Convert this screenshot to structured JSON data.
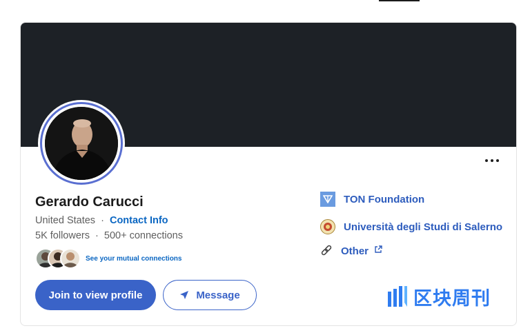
{
  "profile": {
    "name": "Gerardo Carucci",
    "location": "United States",
    "separator": "·",
    "contact_label": "Contact Info",
    "followers": "5K followers",
    "connections": "500+ connections",
    "mutual_label": "See your mutual connections"
  },
  "actions": {
    "join_label": "Join to view profile",
    "message_label": "Message",
    "more_icon": "more-icon"
  },
  "experience": [
    {
      "label": "TON Foundation",
      "icon": "ton-logo-icon"
    },
    {
      "label": "Università degli Studi di Salerno",
      "icon": "university-seal-icon"
    },
    {
      "label": "Other",
      "icon": "link-icon",
      "external_icon": "external-link-icon"
    }
  ],
  "watermark": {
    "text": "区块周刊"
  },
  "colors": {
    "banner": "#1d2126",
    "accent": "#3a63c8",
    "link": "#0a66c2",
    "watermark": "#2f7cf0"
  }
}
